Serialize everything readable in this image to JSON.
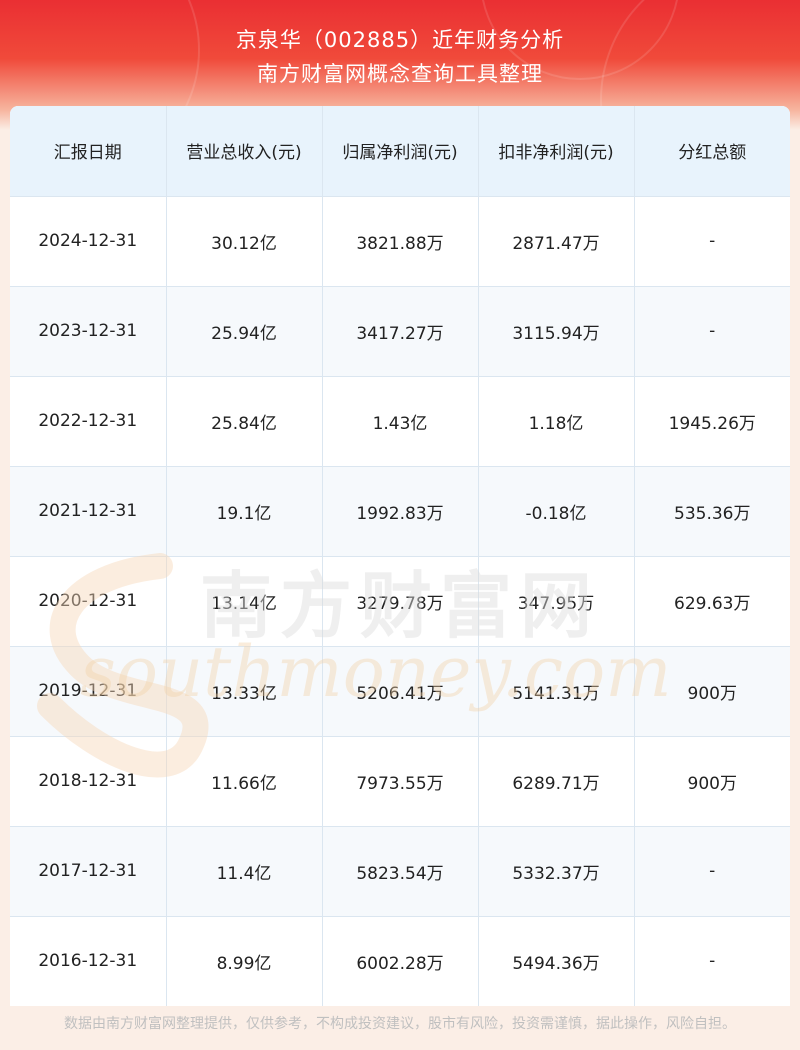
{
  "header": {
    "title": "京泉华（002885）近年财务分析",
    "subtitle": "南方财富网概念查询工具整理"
  },
  "table": {
    "columns": [
      "汇报日期",
      "营业总收入(元)",
      "归属净利润(元)",
      "扣非净利润(元)",
      "分红总额"
    ],
    "rows": [
      [
        "2024-12-31",
        "30.12亿",
        "3821.88万",
        "2871.47万",
        "-"
      ],
      [
        "2023-12-31",
        "25.94亿",
        "3417.27万",
        "3115.94万",
        "-"
      ],
      [
        "2022-12-31",
        "25.84亿",
        "1.43亿",
        "1.18亿",
        "1945.26万"
      ],
      [
        "2021-12-31",
        "19.1亿",
        "1992.83万",
        "-0.18亿",
        "535.36万"
      ],
      [
        "2020-12-31",
        "13.14亿",
        "3279.78万",
        "347.95万",
        "629.63万"
      ],
      [
        "2019-12-31",
        "13.33亿",
        "5206.41万",
        "5141.31万",
        "900万"
      ],
      [
        "2018-12-31",
        "11.66亿",
        "7973.55万",
        "6289.71万",
        "900万"
      ],
      [
        "2017-12-31",
        "11.4亿",
        "5823.54万",
        "5332.37万",
        "-"
      ],
      [
        "2016-12-31",
        "8.99亿",
        "6002.28万",
        "5494.36万",
        "-"
      ]
    ]
  },
  "watermark": {
    "cn": "南方财富网",
    "en": "southmoney.com"
  },
  "footer": {
    "disclaimer": "数据由南方财富网整理提供，仅供参考，不构成投资建议，股市有风险，投资需谨慎，据此操作，风险自担。"
  },
  "colors": {
    "header_red": "#ea2f33",
    "table_header_bg": "#e8f3fc",
    "grid_line": "#dbe6f0"
  }
}
